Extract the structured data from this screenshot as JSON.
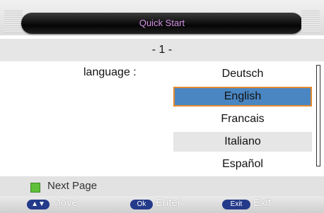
{
  "header": {
    "title": "Quick Start"
  },
  "page": {
    "indicator": "- 1 -"
  },
  "settings": {
    "language_label": "language :",
    "options": [
      "Deutsch",
      "English",
      "Francais",
      "Italiano",
      "Español"
    ],
    "selected": "English"
  },
  "next": {
    "label": "Next Page"
  },
  "hints": {
    "move_key": "▲▼",
    "move_label": "Move",
    "ok_key": "Ok",
    "ok_label": "Enter",
    "exit_key": "Exit",
    "exit_label": "Exit"
  },
  "colors": {
    "title_text": "#d38fe6",
    "selection_fill": "#4a86c2",
    "selection_border": "#e38a2f",
    "green_key": "#5fbf3a",
    "key_fill": "#243a8a"
  }
}
